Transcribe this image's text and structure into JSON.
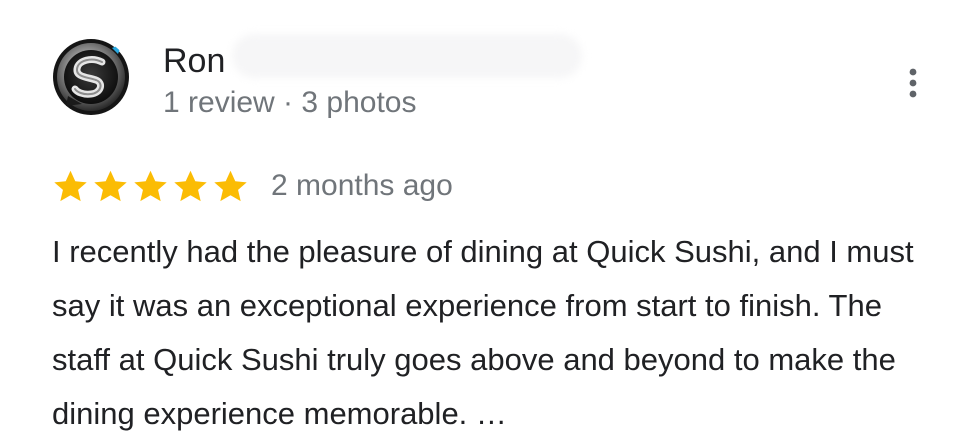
{
  "review": {
    "author": {
      "name": "Ron",
      "meta": "1 review · 3 photos",
      "avatar_icon": "logo-avatar-icon"
    },
    "more_icon": "more-vertical-icon",
    "rating": {
      "stars": 5,
      "max_stars": 5,
      "star_color": "#fbbc04"
    },
    "date": "2 months ago",
    "text": "I recently had the pleasure of dining at Quick Sushi, and I must say it was an exceptional experience from start to finish. The staff at Quick Sushi truly goes above and beyond to make the dining experience memorable. …"
  }
}
